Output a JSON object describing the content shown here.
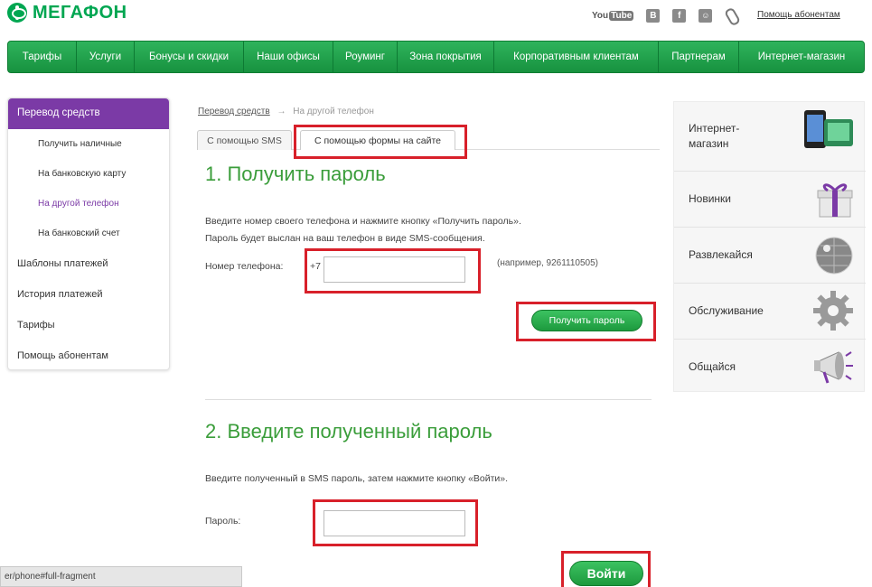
{
  "header": {
    "brand": "МЕГАФОН",
    "youtube_label": "You",
    "youtube_tube": "Tube",
    "social_vk": "В",
    "social_fb": "f",
    "help_link": "Помощь абонентам"
  },
  "nav": {
    "items": [
      "Тарифы",
      "Услуги",
      "Бонусы и скидки",
      "Наши офисы",
      "Роуминг",
      "Зона покрытия",
      "Корпоративным клиентам",
      "Партнерам",
      "Интернет-магазин"
    ]
  },
  "sidebar": {
    "active": "Перевод средств",
    "sub_items": [
      "Получить наличные",
      "На банковскую карту",
      "На другой телефон",
      "На банковский счет"
    ],
    "main_items": [
      "Шаблоны платежей",
      "История платежей",
      "Тарифы",
      "Помощь абонентам"
    ]
  },
  "breadcrumb": {
    "parent": "Перевод средств",
    "arrow": "→",
    "current": "На другой телефон"
  },
  "tabs": {
    "sms": "С помощью SMS",
    "site_form": "С помощью формы на сайте"
  },
  "step1": {
    "title": "1. Получить пароль",
    "desc_line1": "Введите номер своего телефона и нажмите кнопку «Получить пароль».",
    "desc_line2": "Пароль будет выслан на ваш телефон в виде SMS-сообщения.",
    "phone_label": "Номер телефона:",
    "phone_prefix": "+7",
    "phone_value": "",
    "phone_hint": "(например, 9261110505)",
    "button": "Получить пароль"
  },
  "step2": {
    "title": "2. Введите полученный пароль",
    "desc": "Введите полученный в SMS пароль, затем нажмите кнопку «Войти».",
    "password_label": "Пароль:",
    "password_value": "",
    "button": "Войти"
  },
  "promo": {
    "items": [
      "Интернет-магазин",
      "Новинки",
      "Развлекайся",
      "Обслуживание",
      "Общайся"
    ]
  },
  "status_bar": {
    "url": "er/phone#full-fragment"
  },
  "colors": {
    "brand_green": "#00a651",
    "heading_green": "#3a9d3a",
    "purple": "#7b3aa6",
    "highlight_red": "#d8202a"
  }
}
